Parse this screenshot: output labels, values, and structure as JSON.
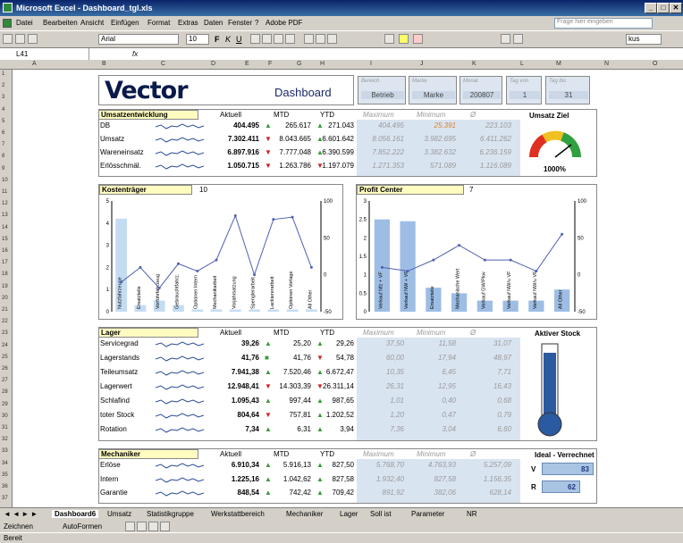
{
  "window": {
    "title": "Microsoft Excel - Dashboard_tgl.xls"
  },
  "menu": [
    "Datei",
    "Bearbeiten",
    "Ansicht",
    "Einfügen",
    "Format",
    "Extras",
    "Daten",
    "Fenster",
    "?",
    "Adobe PDF"
  ],
  "help_placeholder": "Frage hier eingeben",
  "toolbar": {
    "font": "Arial",
    "size": "10",
    "zoom": "kus"
  },
  "formula": {
    "cell_ref": "L41",
    "fx": "fx"
  },
  "columns": [
    "A",
    "B",
    "C",
    "D",
    "E",
    "F",
    "G",
    "H",
    "I",
    "J",
    "K",
    "L",
    "M",
    "N",
    "O"
  ],
  "rows": [
    "1",
    "2",
    "3",
    "4",
    "5",
    "6",
    "7",
    "8",
    "9",
    "10",
    "11",
    "12",
    "13",
    "14",
    "15",
    "16",
    "17",
    "18",
    "19",
    "20",
    "21",
    "22",
    "23",
    "24",
    "25",
    "26",
    "27",
    "28",
    "29",
    "30",
    "31",
    "32",
    "33",
    "34",
    "35",
    "36",
    "37"
  ],
  "header": {
    "logo": "Vector",
    "title": "Dashboard",
    "filters": [
      {
        "label": "Bereich",
        "value": "Betrieb"
      },
      {
        "label": "Marke",
        "value": "Marke"
      },
      {
        "label": "Monat",
        "value": "200807"
      },
      {
        "label": "Tag von",
        "value": "1"
      },
      {
        "label": "Tag bis",
        "value": "31"
      }
    ]
  },
  "colheads": {
    "aktuell": "Aktuell",
    "mtd": "MTD",
    "ytd": "YTD",
    "max": "Maximum",
    "min": "Minimum",
    "avg": "Ø"
  },
  "umsatz": {
    "title": "Umsatzentwicklung",
    "gauge_title": "Umsatz Ziel",
    "gauge_value": "1000%",
    "rows": [
      {
        "name": "DB",
        "aktuell": "404.495",
        "mtd": "265.617",
        "mtd_dir": "up",
        "ytd": "271.043",
        "ytd_dir": "up",
        "max": "404.495",
        "min": "25.391",
        "avg": "223.103"
      },
      {
        "name": "Umsatz",
        "aktuell": "7.302.411",
        "mtd": "8.043.665",
        "mtd_dir": "dn",
        "ytd": "6.601.642",
        "ytd_dir": "up",
        "max": "8.056.161",
        "min": "3.982.695",
        "avg": "6.411.262"
      },
      {
        "name": "Wareneinsatz",
        "aktuell": "6.897.916",
        "mtd": "7.777.048",
        "mtd_dir": "dn",
        "ytd": "6.390.599",
        "ytd_dir": "up",
        "max": "7.852.222",
        "min": "3.382.632",
        "avg": "6.236.159"
      },
      {
        "name": "Erlösschmäl.",
        "aktuell": "1.050.715",
        "mtd": "1.263.786",
        "mtd_dir": "dn",
        "ytd": "1.197.079",
        "ytd_dir": "dn",
        "max": "1.271.353",
        "min": "571.089",
        "avg": "1.116.089"
      }
    ]
  },
  "chart_data": [
    {
      "type": "bar",
      "title": "Kostenträger",
      "title_value": "10",
      "categories": [
        "Nutzfahrzeuge",
        "Ersatzteile",
        "Vorführfahrzeug",
        "Gebrauchtfahrz.",
        "Optionen Intern",
        "Mechanikarbeit",
        "Vorjahrsatzung",
        "Spenglerarbeit",
        "Lackiererarbeit",
        "Optionen Vorlage",
        "All Other"
      ],
      "values": [
        4.2,
        0.3,
        0.5,
        0.3,
        0.1,
        0.1,
        0.1,
        0.1,
        0.1,
        0.1,
        0.1
      ],
      "line": [
        -10,
        10,
        -18,
        15,
        5,
        20,
        80,
        0,
        75,
        78,
        10
      ],
      "ylim": [
        0,
        5
      ],
      "y2lim": [
        -50,
        100
      ],
      "yticks": [
        "0",
        "1",
        "2",
        "3",
        "4",
        "5"
      ],
      "y2ticks": [
        "-50",
        "0",
        "50",
        "100"
      ]
    },
    {
      "type": "bar",
      "title": "Profit Center",
      "title_value": "7",
      "categories": [
        "Verkauf Nfz + VF",
        "Verkauf NW + VF",
        "Ersatzteile",
        "Mechanische Wert",
        "Verkauf GW/Pkw",
        "Verkauf NW/u VF",
        "Verkauf NW/u VF",
        "All Other"
      ],
      "values": [
        2.5,
        2.45,
        0.65,
        0.5,
        0.3,
        0.3,
        0.3,
        0.6
      ],
      "line": [
        10,
        5,
        20,
        40,
        20,
        20,
        5,
        55
      ],
      "ylim": [
        0,
        3
      ],
      "y2lim": [
        -50,
        100
      ],
      "yticks": [
        "0",
        "0.5",
        "1",
        "1.5",
        "2",
        "2.5",
        "3"
      ],
      "y2ticks": [
        "-50",
        "0",
        "50",
        "100"
      ]
    }
  ],
  "lager": {
    "title": "Lager",
    "gauge_title": "Aktiver Stock",
    "rows": [
      {
        "name": "Servicegrad",
        "aktuell": "39,26",
        "mtd": "25,20",
        "mtd_dir": "up",
        "ytd": "29,26",
        "ytd_dir": "up",
        "max": "37,50",
        "min": "11,58",
        "avg": "31,07"
      },
      {
        "name": "Lagerstands",
        "aktuell": "41,76",
        "mtd": "41,76",
        "mtd_dir": "eq",
        "ytd": "54,78",
        "ytd_dir": "dn",
        "max": "60,00",
        "min": "17,94",
        "avg": "48,97"
      },
      {
        "name": "Teileumsatz",
        "aktuell": "7.941,38",
        "mtd": "7.520,46",
        "mtd_dir": "up",
        "ytd": "6.672,47",
        "ytd_dir": "up",
        "max": "10,35",
        "min": "6,45",
        "avg": "7,71"
      },
      {
        "name": "Lagerwert",
        "aktuell": "12.948,41",
        "mtd": "14.303,39",
        "mtd_dir": "dn",
        "ytd": "26.311,14",
        "ytd_dir": "dn",
        "max": "26,31",
        "min": "12,95",
        "avg": "16,43"
      },
      {
        "name": "Schlafind",
        "aktuell": "1.095,43",
        "mtd": "997,44",
        "mtd_dir": "up",
        "ytd": "987,65",
        "ytd_dir": "up",
        "max": "1,01",
        "min": "0,40",
        "avg": "0,68"
      },
      {
        "name": "toter Stock",
        "aktuell": "804,64",
        "mtd": "757,81",
        "mtd_dir": "dn",
        "ytd": "1.202,52",
        "ytd_dir": "up",
        "max": "1,20",
        "min": "0,47",
        "avg": "0,79"
      },
      {
        "name": "Rotation",
        "aktuell": "7,34",
        "mtd": "6,31",
        "mtd_dir": "up",
        "ytd": "3,94",
        "ytd_dir": "up",
        "max": "7,36",
        "min": "3,04",
        "avg": "6,60"
      }
    ]
  },
  "mechaniker": {
    "title": "Mechaniker",
    "gauge_title": "Ideal - Verrechnet",
    "bars": [
      {
        "label": "V",
        "value": "83"
      },
      {
        "label": "R",
        "value": "62"
      }
    ],
    "rows": [
      {
        "name": "Erlöse",
        "aktuell": "6.910,34",
        "mtd": "5.916,13",
        "mtd_dir": "up",
        "ytd": "827,50",
        "ytd_dir": "up",
        "max": "5.768,70",
        "min": "4.763,93",
        "avg": "5.257,09"
      },
      {
        "name": "Intern",
        "aktuell": "1.225,16",
        "mtd": "1.042,62",
        "mtd_dir": "up",
        "ytd": "827,58",
        "ytd_dir": "up",
        "max": "1.932,40",
        "min": "827,58",
        "avg": "1.156,35"
      },
      {
        "name": "Garantie",
        "aktuell": "848,54",
        "mtd": "742,42",
        "mtd_dir": "up",
        "ytd": "709,42",
        "ytd_dir": "up",
        "max": "891,92",
        "min": "382,06",
        "avg": "628,14"
      }
    ]
  },
  "tabs": [
    "Dashboard6",
    "Umsatz",
    "Statistikgruppe",
    "Werkstattbereich",
    "Mechaniker",
    "Lager",
    "Soll ist",
    "Parameter",
    "NR"
  ],
  "drawbar": {
    "zeichnen": "Zeichnen",
    "autoformen": "AutoFormen"
  },
  "status": "Bereit"
}
